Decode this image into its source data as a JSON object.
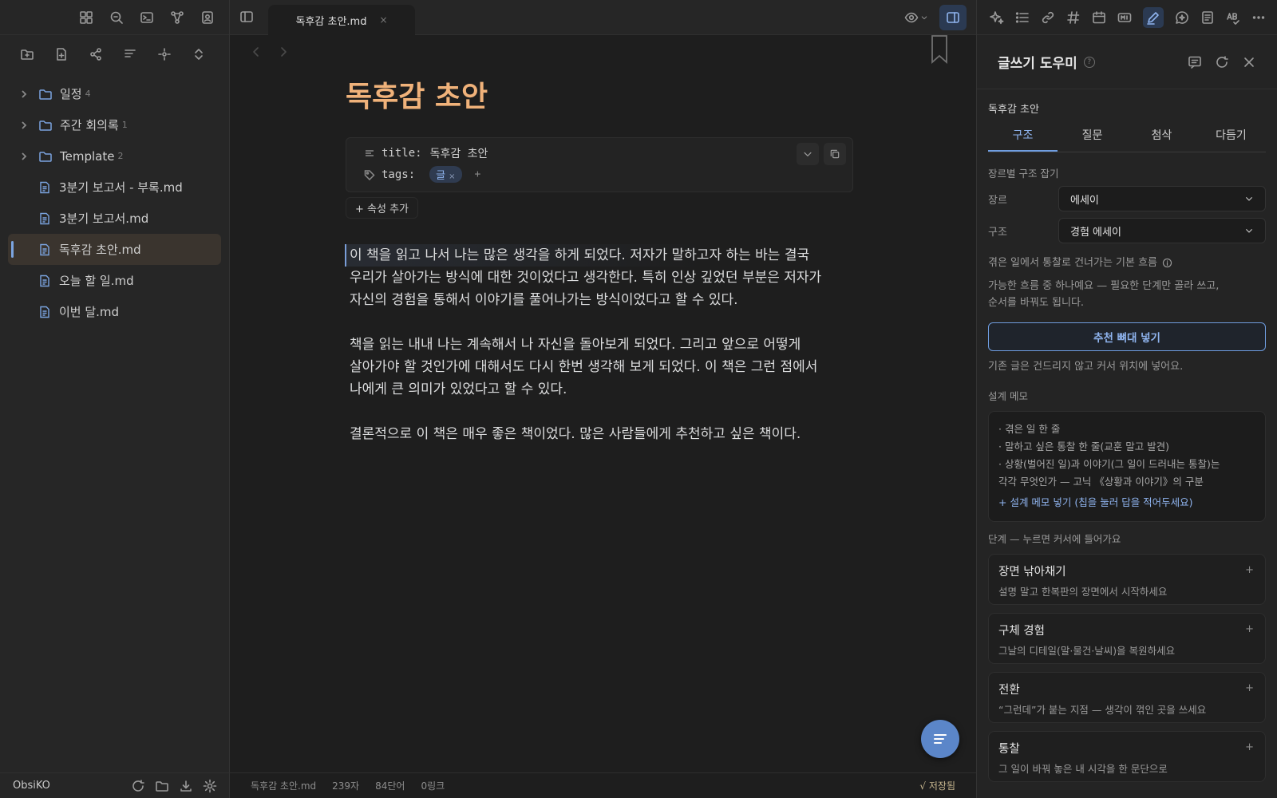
{
  "app": {
    "name": "ObsiKO"
  },
  "sidebar": {
    "tree": [
      {
        "type": "folder",
        "label": "일정",
        "count": "4"
      },
      {
        "type": "folder",
        "label": "주간 회의록",
        "count": "1"
      },
      {
        "type": "folder",
        "label": "Template",
        "count": "2"
      },
      {
        "type": "file",
        "label": "3분기 보고서 - 부록.md"
      },
      {
        "type": "file",
        "label": "3분기 보고서.md"
      },
      {
        "type": "file",
        "label": "독후감 초안.md",
        "active": true
      },
      {
        "type": "file",
        "label": "오늘 할 일.md"
      },
      {
        "type": "file",
        "label": "이번 달.md"
      }
    ]
  },
  "tab": {
    "label": "독후감 초안.md",
    "close": "×"
  },
  "note": {
    "title": "독후감 초안",
    "properties": {
      "title_key": "title:",
      "title_value": "독후감 초안",
      "tags_key": "tags:",
      "tag": "글",
      "tag_remove": "×",
      "tag_add": "+"
    },
    "add_property": "+ 속성 추가",
    "lines": [
      "이 책을 읽고 나서 나는 많은 생각을 하게 되었다. 저자가 말하고자 하는 바는 결국",
      "우리가 살아가는 방식에 대한 것이었다고 생각한다. 특히 인상 깊었던 부분은 저자가",
      "자신의 경험을 통해서 이야기를 풀어나가는 방식이었다고 할 수 있다.",
      "책을 읽는 내내 나는 계속해서 나 자신을 돌아보게 되었다. 그리고 앞으로 어떻게",
      "살아가야 할 것인가에 대해서도 다시 한번 생각해 보게 되었다. 이 책은 그런 점에서",
      "나에게 큰 의미가 있었다고 할 수 있다.",
      "결론적으로 이 책은 매우 좋은 책이었다. 많은 사람들에게 추천하고 싶은 책이다."
    ]
  },
  "status": {
    "file": "독후감 초안.md",
    "chars": "239자",
    "words": "84단어",
    "links": "0링크",
    "saved": "√ 저장됨"
  },
  "panel": {
    "title": "글쓰기 도우미",
    "help": "?",
    "doc_name": "독후감 초안",
    "tabs": [
      "구조",
      "질문",
      "첨삭",
      "다듬기"
    ],
    "active_tab": 0,
    "section_genre": "장르별 구조 잡기",
    "genre_label": "장르",
    "genre_value": "에세이",
    "structure_label": "구조",
    "structure_value": "경험 에세이",
    "flow_title": "겪은 일에서 통찰로 건너가는 기본 흐름",
    "flow_desc_1": "가능한 흐름 중 하나예요 — 필요한 단계만 골라 쓰고,",
    "flow_desc_2": "순서를 바꿔도 됩니다.",
    "insert_button": "추천 뼈대 넣기",
    "insert_hint": "기존 글은 건드리지 않고 커서 위치에 넣어요.",
    "memo_title": "설계 메모",
    "memo_items": [
      "· 겪은 일 한 줄",
      "· 말하고 싶은 통찰 한 줄(교훈 말고 발견)",
      "· 상황(벌어진 일)과 이야기(그 일이 드러내는 통찰)는",
      "각각 무엇인가 — 고닉 《상황과 이야기》의 구분"
    ],
    "memo_add": "+ 설계 메모 넣기 (칩을 눌러 답을 적어두세요)",
    "steps_title": "단계 — 누르면 커서에 들어가요",
    "steps": [
      {
        "title": "장면 낚아채기",
        "desc": "설명 말고 한복판의 장면에서 시작하세요",
        "add": "+"
      },
      {
        "title": "구체 경험",
        "desc": "그날의 디테일(말·물건·날씨)을 복원하세요",
        "add": "+"
      },
      {
        "title": "전환",
        "desc": "“그런데”가 붙는 지점 — 생각이 꺾인 곳을 쓰세요",
        "add": "+"
      },
      {
        "title": "통찰",
        "desc": "그 일이 바꿔 놓은 내 시각을 한 문단으로",
        "add": "+"
      }
    ]
  }
}
